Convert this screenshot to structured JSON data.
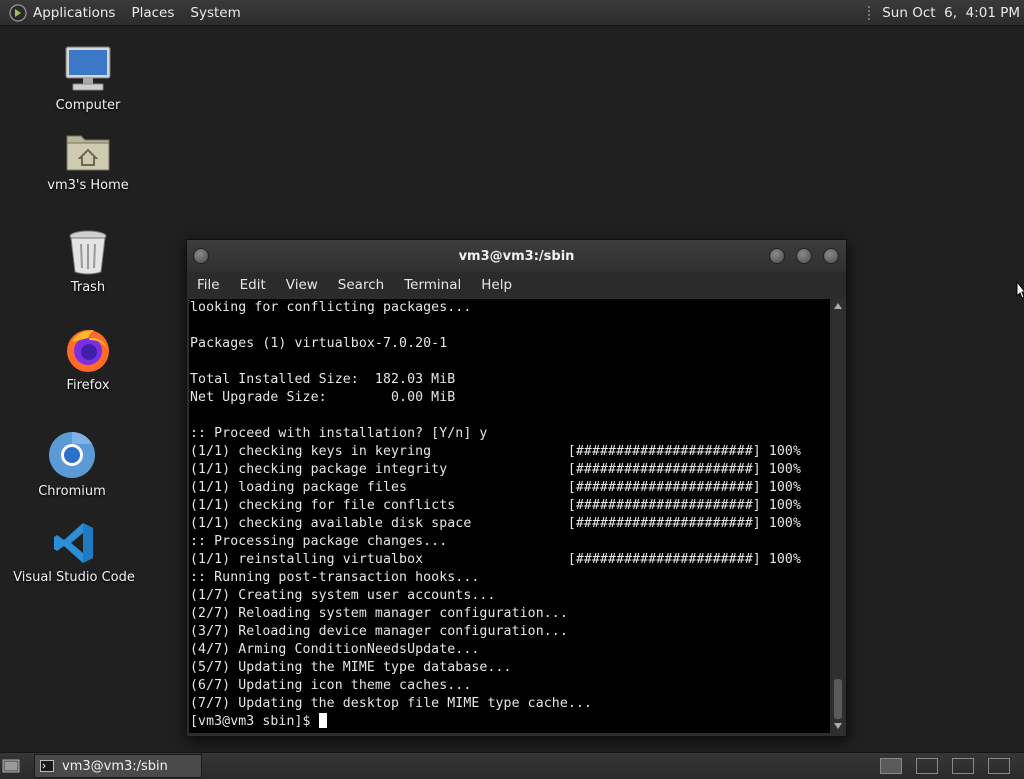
{
  "top_panel": {
    "menus": [
      "Applications",
      "Places",
      "System"
    ],
    "clock": "Sun Oct  6,  4:01 PM"
  },
  "desktop_icons": [
    {
      "label": "Computer",
      "icon": "computer-icon"
    },
    {
      "label": "vm3's Home",
      "icon": "home-folder-icon"
    },
    {
      "label": "Trash",
      "icon": "trash-icon"
    },
    {
      "label": "Firefox",
      "icon": "firefox-icon"
    },
    {
      "label": "Chromium",
      "icon": "chromium-icon"
    },
    {
      "label": "Visual Studio Code",
      "icon": "vscode-icon"
    }
  ],
  "terminal": {
    "title": "vm3@vm3:/sbin",
    "menus": [
      "File",
      "Edit",
      "View",
      "Search",
      "Terminal",
      "Help"
    ],
    "lines": [
      "looking for conflicting packages...",
      "",
      "Packages (1) virtualbox-7.0.20-1",
      "",
      "Total Installed Size:  182.03 MiB",
      "Net Upgrade Size:        0.00 MiB",
      "",
      ":: Proceed with installation? [Y/n] y",
      "(1/1) checking keys in keyring                 [######################] 100%",
      "(1/1) checking package integrity               [######################] 100%",
      "(1/1) loading package files                    [######################] 100%",
      "(1/1) checking for file conflicts              [######################] 100%",
      "(1/1) checking available disk space            [######################] 100%",
      ":: Processing package changes...",
      "(1/1) reinstalling virtualbox                  [######################] 100%",
      ":: Running post-transaction hooks...",
      "(1/7) Creating system user accounts...",
      "(2/7) Reloading system manager configuration...",
      "(3/7) Reloading device manager configuration...",
      "(4/7) Arming ConditionNeedsUpdate...",
      "(5/7) Updating the MIME type database...",
      "(6/7) Updating icon theme caches...",
      "(7/7) Updating the desktop file MIME type cache..."
    ],
    "prompt": "[vm3@vm3 sbin]$ "
  },
  "taskbar": {
    "window_button": "vm3@vm3:/sbin"
  },
  "colors": {
    "panel": "#2c2c2c",
    "desktop": "#202020",
    "terminal_bg": "#000000",
    "terminal_fg": "#e6e6e6"
  }
}
